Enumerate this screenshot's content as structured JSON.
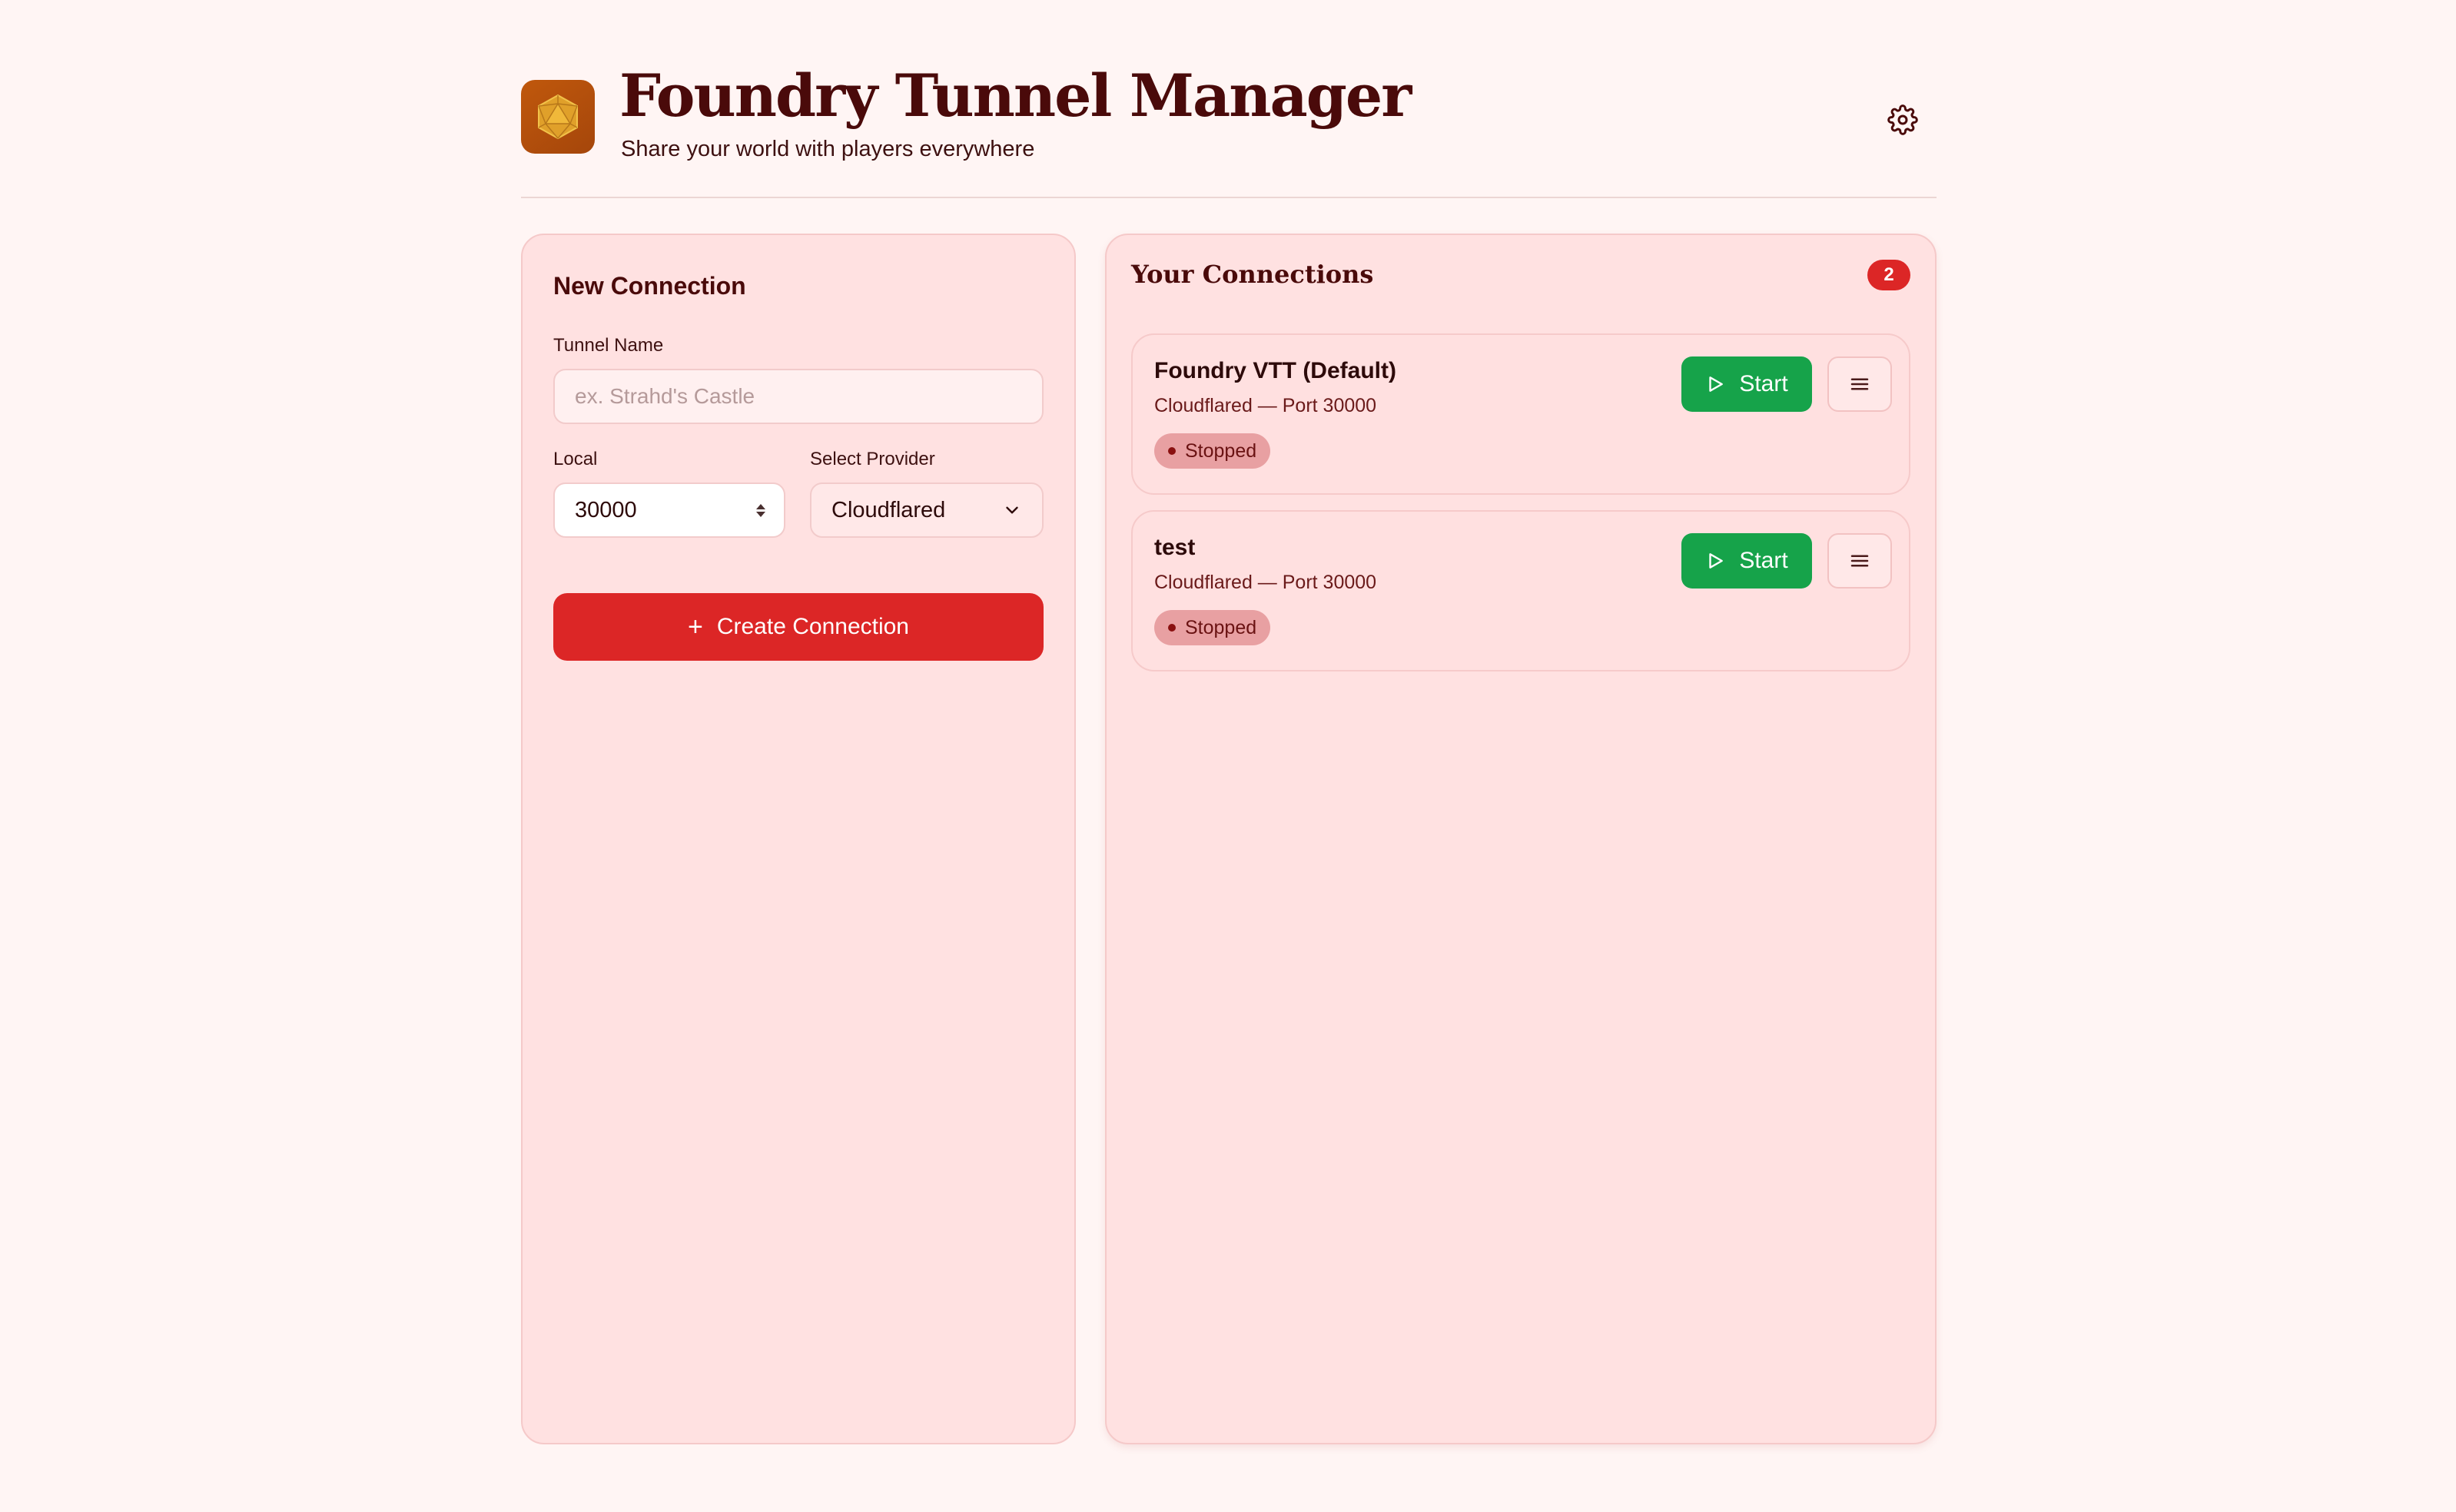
{
  "header": {
    "title": "Foundry Tunnel Manager",
    "subtitle": "Share your world with players everywhere",
    "logo_icon": "d20-icon",
    "settings_icon": "gear-icon"
  },
  "new_connection": {
    "heading": "New Connection",
    "tunnel_name_label": "Tunnel Name",
    "tunnel_name_placeholder": "ex. Strahd's Castle",
    "tunnel_name_value": "",
    "local_label": "Local",
    "local_value": "30000",
    "provider_label": "Select Provider",
    "provider_value": "Cloudflared",
    "create_label": "Create Connection"
  },
  "connections": {
    "heading": "Your Connections",
    "count": "2",
    "items": [
      {
        "name": "Foundry VTT (Default)",
        "meta": "Cloudflared — Port 30000",
        "status": "Stopped",
        "start_label": "Start"
      },
      {
        "name": "test",
        "meta": "Cloudflared — Port 30000",
        "status": "Stopped",
        "start_label": "Start"
      }
    ]
  },
  "colors": {
    "background": "#fff5f4",
    "panel": "#ffe1e1",
    "primary_red": "#dc2626",
    "start_green": "#16a34a",
    "logo_orange": "#c0580c",
    "text_dark": "#4a0a0a"
  }
}
